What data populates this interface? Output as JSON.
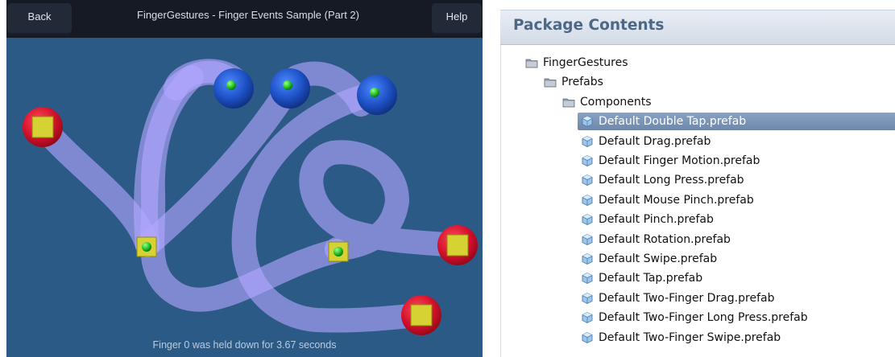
{
  "game": {
    "back_label": "Back",
    "title": "FingerGestures - Finger Events Sample (Part 2)",
    "help_label": "Help",
    "status": "Finger 0 was held down for 3.67 seconds",
    "colors": {
      "background": "#2c5a86",
      "bar": "#151a24",
      "trail": "#b3a6ff",
      "red_ball": "#d3102b",
      "blue_ball": "#1c4fc2",
      "dot": "#27c62a",
      "square": "#d6d233"
    }
  },
  "package": {
    "title": "Package Contents",
    "tree": [
      {
        "label": "FingerGestures",
        "icon": "folder-icon",
        "depth": 0,
        "selected": false
      },
      {
        "label": "Prefabs",
        "icon": "folder-icon",
        "depth": 1,
        "selected": false
      },
      {
        "label": "Components",
        "icon": "folder-icon",
        "depth": 2,
        "selected": false
      },
      {
        "label": "Default Double Tap.prefab",
        "icon": "prefab-cube-icon",
        "depth": 3,
        "selected": true
      },
      {
        "label": "Default Drag.prefab",
        "icon": "prefab-cube-icon",
        "depth": 3,
        "selected": false
      },
      {
        "label": "Default Finger Motion.prefab",
        "icon": "prefab-cube-icon",
        "depth": 3,
        "selected": false
      },
      {
        "label": "Default Long Press.prefab",
        "icon": "prefab-cube-icon",
        "depth": 3,
        "selected": false
      },
      {
        "label": "Default Mouse Pinch.prefab",
        "icon": "prefab-cube-icon",
        "depth": 3,
        "selected": false
      },
      {
        "label": "Default Pinch.prefab",
        "icon": "prefab-cube-icon",
        "depth": 3,
        "selected": false
      },
      {
        "label": "Default Rotation.prefab",
        "icon": "prefab-cube-icon",
        "depth": 3,
        "selected": false
      },
      {
        "label": "Default Swipe.prefab",
        "icon": "prefab-cube-icon",
        "depth": 3,
        "selected": false
      },
      {
        "label": "Default Tap.prefab",
        "icon": "prefab-cube-icon",
        "depth": 3,
        "selected": false
      },
      {
        "label": "Default Two-Finger Drag.prefab",
        "icon": "prefab-cube-icon",
        "depth": 3,
        "selected": false
      },
      {
        "label": "Default Two-Finger Long Press.prefab",
        "icon": "prefab-cube-icon",
        "depth": 3,
        "selected": false
      },
      {
        "label": "Default Two-Finger Swipe.prefab",
        "icon": "prefab-cube-icon",
        "depth": 3,
        "selected": false
      }
    ],
    "colors": {
      "header_text": "#4d6785",
      "selection": "#7a93b6"
    }
  }
}
